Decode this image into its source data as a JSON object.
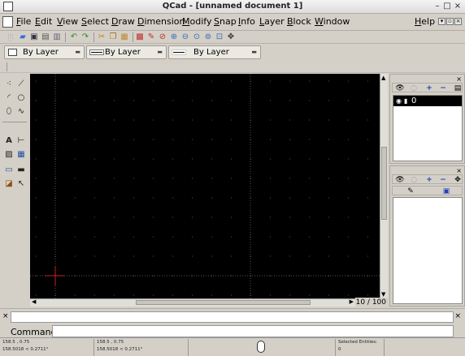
{
  "window": {
    "title": "QCad - [unnamed document 1]",
    "controls": [
      "–",
      "□",
      "×"
    ]
  },
  "menu": {
    "items": [
      "File",
      "Edit",
      "View",
      "Select",
      "Draw",
      "Dimension",
      "Modify",
      "Snap",
      "Info",
      "Layer",
      "Block",
      "Window"
    ],
    "help": "Help"
  },
  "pen": {
    "color": "By Layer",
    "width": "By Layer",
    "linetype": "By Layer"
  },
  "layers": {
    "items": [
      "0"
    ]
  },
  "grid": {
    "info": "10 / 100"
  },
  "command": {
    "label": "Command:"
  },
  "status": {
    "abs_coord": "158.5 , 0.75",
    "abs_polar": "158.5018 < 0.2711°",
    "rel_coord": "158.5 , 0.75",
    "rel_polar": "158.5018 < 0.2711°",
    "selected_label": "Selected Entities:",
    "selected_count": "0"
  },
  "colors": {
    "canvas": "#000000",
    "grid": "#555555",
    "crosshair": "#cc2222",
    "layer_selected": "#000000"
  }
}
